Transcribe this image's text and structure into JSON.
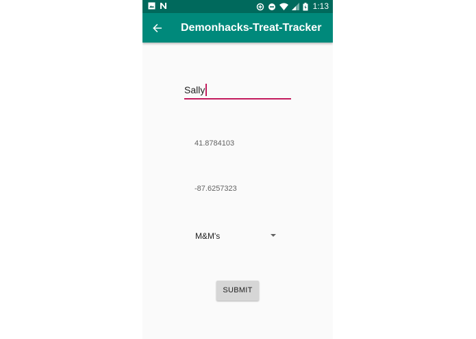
{
  "status_bar": {
    "time": "1:13",
    "left_icons": [
      "image-icon",
      "n-notification-icon"
    ],
    "right_icons": [
      "data-saver-icon",
      "do-not-disturb-icon",
      "wifi-icon",
      "signal-icon",
      "battery-icon"
    ]
  },
  "app_bar": {
    "title": "Demonhacks-Treat-Tracker",
    "back_icon": "arrow-back-icon"
  },
  "form": {
    "name_value": "Sally",
    "latitude": "41.8784103",
    "longitude": "-87.6257323",
    "treat_selected": "M&M's",
    "submit_label": "SUBMIT"
  },
  "colors": {
    "status_bar": "#00695c",
    "app_bar": "#00897b",
    "accent": "#c2185b",
    "background": "#fafafa",
    "button": "#d6d6d6"
  }
}
